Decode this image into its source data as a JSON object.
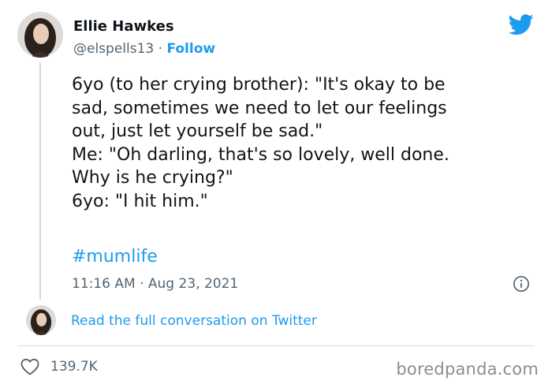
{
  "author": {
    "name": "Ellie Hawkes",
    "handle": "@elspells13",
    "separator": "·",
    "follow_label": "Follow",
    "avatar_icon": "avatar-photo"
  },
  "tweet": {
    "lines": [
      "6yo (to her crying brother): \"It's okay to be",
      "sad, sometimes we need to let our feelings",
      "out, just let yourself be sad.\"",
      "Me: \"Oh darling, that's so lovely, well done.",
      "Why is he crying?\"",
      "6yo: \"I hit him.\""
    ],
    "hashtag": "#mumlife",
    "timestamp": "11:16 AM · Aug 23, 2021"
  },
  "footer": {
    "read_conversation_label": "Read the full conversation on Twitter",
    "like_count": "139.7K",
    "watermark": "boredpanda.com"
  },
  "colors": {
    "link": "#1d9bf0",
    "text": "#0f1419",
    "muted": "#536471",
    "divider": "#cfd9de"
  },
  "icons": [
    "twitter-bird-icon",
    "info-icon",
    "heart-icon"
  ]
}
